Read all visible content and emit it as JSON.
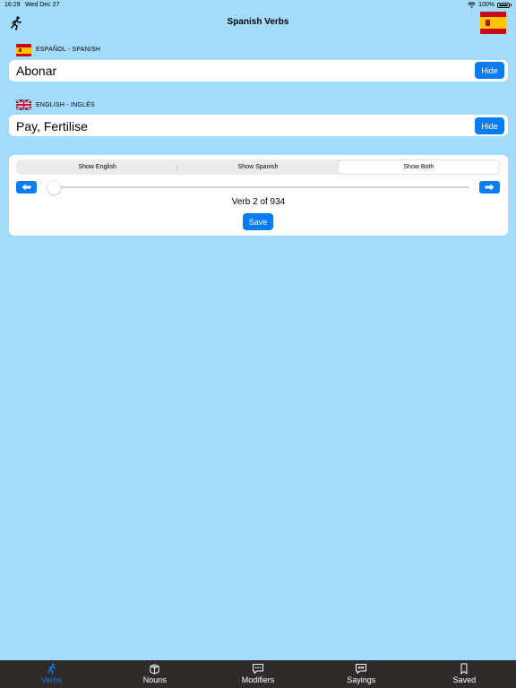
{
  "status_bar": {
    "time": "16:29",
    "date": "Wed Dec 27",
    "battery": "100%"
  },
  "nav": {
    "title": "Spanish Verbs"
  },
  "spanish": {
    "label": "ESPAÑOL - SPANISH",
    "word": "Abonar",
    "hide_label": "Hide"
  },
  "english": {
    "label": "ENGLISH - INGLÉS",
    "word": "Pay, Fertilise",
    "hide_label": "Hide"
  },
  "controls": {
    "segments": [
      "Show English",
      "Show Spanish",
      "Show Both"
    ],
    "selected_segment": "Show Both",
    "counter": "Verb 2 of 934",
    "slider_value_fraction": 0.001,
    "save_label": "Save"
  },
  "tabs": [
    {
      "label": "Verbs",
      "icon": "runner-icon",
      "active": true
    },
    {
      "label": "Nouns",
      "icon": "cubes-icon",
      "active": false
    },
    {
      "label": "Modifiers",
      "icon": "chat-dots-icon",
      "active": false
    },
    {
      "label": "Sayings",
      "icon": "quote-bubble-icon",
      "active": false
    },
    {
      "label": "Saved",
      "icon": "bookmark-icon",
      "active": false
    }
  ],
  "colors": {
    "background": "#a3dcfb",
    "accent": "#0a7cf2",
    "tabbar": "#2f2b29"
  }
}
